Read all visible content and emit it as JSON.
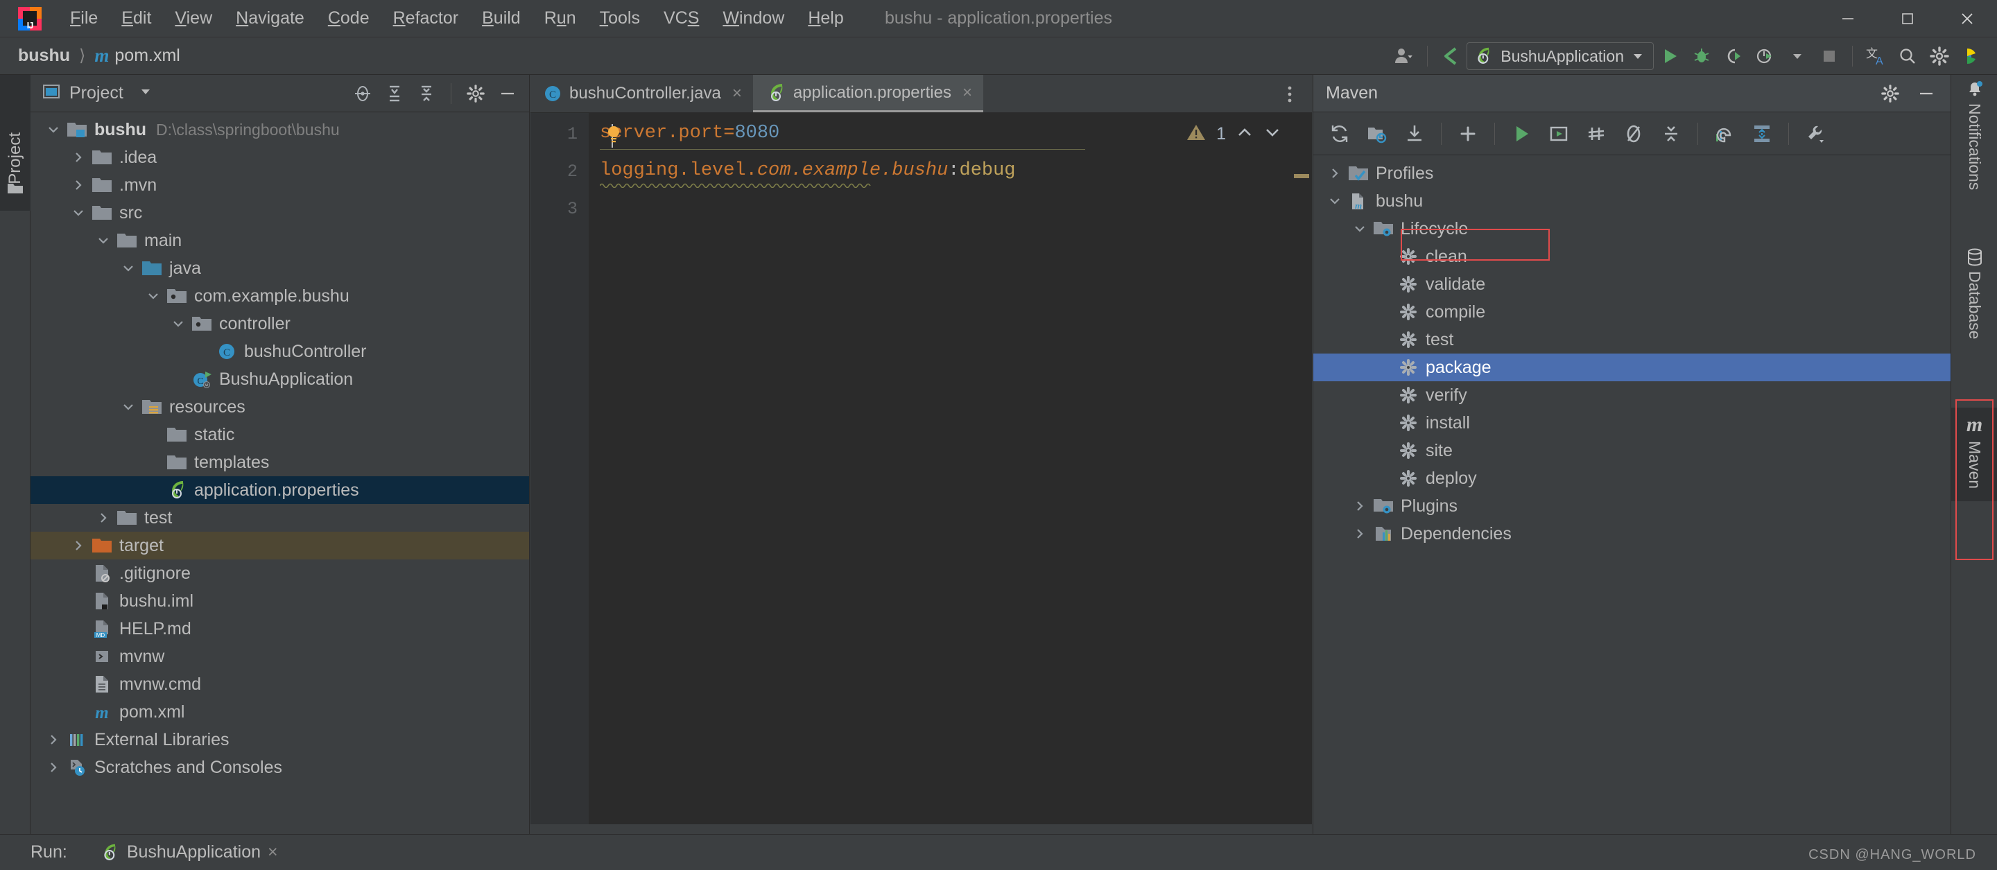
{
  "window": {
    "title": "bushu - application.properties",
    "app_icon": "intellij-logo",
    "controls": {
      "minimize": "minimize-icon",
      "maximize": "maximize-icon",
      "close": "close-icon"
    }
  },
  "menubar": {
    "items": [
      {
        "label": "File",
        "mnemonic": "F"
      },
      {
        "label": "Edit",
        "mnemonic": "E"
      },
      {
        "label": "View",
        "mnemonic": "V"
      },
      {
        "label": "Navigate",
        "mnemonic": "N"
      },
      {
        "label": "Code",
        "mnemonic": "C"
      },
      {
        "label": "Refactor",
        "mnemonic": "R"
      },
      {
        "label": "Build",
        "mnemonic": "B"
      },
      {
        "label": "Run",
        "mnemonic": "u"
      },
      {
        "label": "Tools",
        "mnemonic": "T"
      },
      {
        "label": "VCS",
        "mnemonic": "S"
      },
      {
        "label": "Window",
        "mnemonic": "W"
      },
      {
        "label": "Help",
        "mnemonic": "H"
      }
    ]
  },
  "navbar": {
    "breadcrumbs": [
      "bushu",
      "pom.xml"
    ],
    "run_configuration": "BushuApplication",
    "buttons": [
      "avatar-icon",
      "update-project-icon",
      "run-icon",
      "debug-icon",
      "run-coverage-icon",
      "profile-icon",
      "stop-icon",
      "translate-icon",
      "search-icon",
      "settings-icon",
      "ide-helper-icon"
    ]
  },
  "left_strip": {
    "tool_window": "Project"
  },
  "project_panel": {
    "title": "Project",
    "tools": [
      "locate-icon",
      "expand-all-icon",
      "collapse-all-icon",
      "gear-icon",
      "hide-icon"
    ],
    "tree": [
      {
        "label": "bushu",
        "sub": "D:\\class\\springboot\\bushu",
        "icon": "module-folder-icon",
        "depth": 0,
        "arrow": "down",
        "bold": true
      },
      {
        "label": ".idea",
        "icon": "folder-icon",
        "depth": 1,
        "arrow": "right"
      },
      {
        "label": ".mvn",
        "icon": "folder-icon",
        "depth": 1,
        "arrow": "right"
      },
      {
        "label": "src",
        "icon": "folder-icon",
        "depth": 1,
        "arrow": "down"
      },
      {
        "label": "main",
        "icon": "folder-icon",
        "depth": 2,
        "arrow": "down"
      },
      {
        "label": "java",
        "icon": "source-folder-icon",
        "depth": 3,
        "arrow": "down"
      },
      {
        "label": "com.example.bushu",
        "icon": "package-icon",
        "depth": 4,
        "arrow": "down"
      },
      {
        "label": "controller",
        "icon": "package-icon",
        "depth": 5,
        "arrow": "down"
      },
      {
        "label": "bushuController",
        "icon": "java-class-icon",
        "depth": 6,
        "arrow": "none"
      },
      {
        "label": "BushuApplication",
        "icon": "spring-boot-run-icon",
        "depth": 5,
        "arrow": "none"
      },
      {
        "label": "resources",
        "icon": "resources-folder-icon",
        "depth": 3,
        "arrow": "down"
      },
      {
        "label": "static",
        "icon": "folder-icon",
        "depth": 4,
        "arrow": "none"
      },
      {
        "label": "templates",
        "icon": "folder-icon",
        "depth": 4,
        "arrow": "none"
      },
      {
        "label": "application.properties",
        "icon": "spring-properties-icon",
        "depth": 4,
        "arrow": "none",
        "state": "selected-blue"
      },
      {
        "label": "test",
        "icon": "folder-icon",
        "depth": 2,
        "arrow": "right"
      },
      {
        "label": "target",
        "icon": "excluded-folder-icon",
        "depth": 1,
        "arrow": "right",
        "state": "selected-tan"
      },
      {
        "label": ".gitignore",
        "icon": "gitignore-file-icon",
        "depth": 1,
        "arrow": "none"
      },
      {
        "label": "bushu.iml",
        "icon": "iml-file-icon",
        "depth": 1,
        "arrow": "none"
      },
      {
        "label": "HELP.md",
        "icon": "markdown-file-icon",
        "depth": 1,
        "arrow": "none"
      },
      {
        "label": "mvnw",
        "icon": "shell-script-icon",
        "depth": 1,
        "arrow": "none"
      },
      {
        "label": "mvnw.cmd",
        "icon": "cmd-file-icon",
        "depth": 1,
        "arrow": "none"
      },
      {
        "label": "pom.xml",
        "icon": "maven-pom-icon",
        "depth": 1,
        "arrow": "none"
      },
      {
        "label": "External Libraries",
        "icon": "libraries-icon",
        "depth": 0,
        "arrow": "right"
      },
      {
        "label": "Scratches and Consoles",
        "icon": "scratches-icon",
        "depth": 0,
        "arrow": "right"
      }
    ]
  },
  "editor": {
    "tabs": [
      {
        "label": "bushuController.java",
        "icon": "java-class-icon",
        "active": false,
        "close": "×"
      },
      {
        "label": "application.properties",
        "icon": "spring-properties-icon",
        "active": true,
        "close": "×"
      }
    ],
    "more_icon": "more-vertical-icon",
    "line_numbers": [
      "1",
      "2",
      "3"
    ],
    "lines": [
      {
        "n": 1,
        "segments": [
          {
            "text": "server.port",
            "cls": "tok-orange"
          },
          {
            "text": "=",
            "cls": "tok-orange"
          },
          {
            "text": "8080",
            "cls": "tok-num"
          }
        ]
      },
      {
        "n": 2,
        "segments": [
          {
            "text": "logging.level.",
            "cls": "tok-orange"
          },
          {
            "text": "com.example.bushu",
            "cls": "tok-orange tok-italic"
          },
          {
            "text": ":",
            "cls": "tok-val"
          },
          {
            "text": "debug",
            "cls": "tok-yellow"
          }
        ]
      },
      {
        "n": 3,
        "segments": []
      }
    ],
    "inspection": {
      "icon": "warning-triangle-icon",
      "count": "1",
      "up": "chevron-up-icon",
      "down": "chevron-down-icon"
    },
    "gutter_hint": "intention-bulb-icon"
  },
  "maven_panel": {
    "title": "Maven",
    "head_tools": [
      "gear-icon",
      "hide-icon"
    ],
    "toolbar": [
      "reload-all-icon",
      "generate-sources-icon",
      "download-sources-icon",
      "add-maven-project-icon",
      "run-icon",
      "run-build-icon",
      "toggle-skip-tests-icon",
      "toggle-offline-icon",
      "collapse-all-icon",
      "show-dependencies-icon",
      "execute-goal-icon",
      "maven-settings-icon"
    ],
    "tree": [
      {
        "label": "Profiles",
        "icon": "profiles-icon",
        "depth": 0,
        "arrow": "right"
      },
      {
        "label": "bushu",
        "icon": "maven-module-icon",
        "depth": 0,
        "arrow": "down"
      },
      {
        "label": "Lifecycle",
        "icon": "lifecycle-folder-icon",
        "depth": 1,
        "arrow": "down"
      },
      {
        "label": "clean",
        "icon": "goal-icon",
        "depth": 2,
        "arrow": "none"
      },
      {
        "label": "validate",
        "icon": "goal-icon",
        "depth": 2,
        "arrow": "none"
      },
      {
        "label": "compile",
        "icon": "goal-icon",
        "depth": 2,
        "arrow": "none"
      },
      {
        "label": "test",
        "icon": "goal-icon",
        "depth": 2,
        "arrow": "none"
      },
      {
        "label": "package",
        "icon": "goal-icon",
        "depth": 2,
        "arrow": "none",
        "state": "selected"
      },
      {
        "label": "verify",
        "icon": "goal-icon",
        "depth": 2,
        "arrow": "none"
      },
      {
        "label": "install",
        "icon": "goal-icon",
        "depth": 2,
        "arrow": "none"
      },
      {
        "label": "site",
        "icon": "goal-icon",
        "depth": 2,
        "arrow": "none"
      },
      {
        "label": "deploy",
        "icon": "goal-icon",
        "depth": 2,
        "arrow": "none"
      },
      {
        "label": "Plugins",
        "icon": "plugins-folder-icon",
        "depth": 1,
        "arrow": "right"
      },
      {
        "label": "Dependencies",
        "icon": "dependencies-icon",
        "depth": 1,
        "arrow": "right"
      }
    ]
  },
  "right_strip": {
    "items": [
      {
        "label": "Notifications",
        "icon": "bell-icon"
      },
      {
        "label": "Database",
        "icon": "database-icon"
      },
      {
        "label": "Maven",
        "icon": "maven-m-icon",
        "active": true
      }
    ]
  },
  "bottom": {
    "run_label": "Run:",
    "run_tab": "BushuApplication",
    "run_tab_icon": "spring-boot-icon",
    "run_tab_close": "×"
  },
  "watermark": "CSDN @HANG_WORLD",
  "colors": {
    "accent_blue": "#4b6eaf",
    "selection_blue": "#0d293e",
    "selection_tan": "#4e4733",
    "highlight_red": "#e04b4b",
    "editor_bg": "#2b2b2b",
    "panel_bg": "#3c3f41",
    "text": "#bbbbbb",
    "orange": "#cc7832",
    "number_blue": "#6897bb",
    "spring_green": "#6db33f"
  }
}
